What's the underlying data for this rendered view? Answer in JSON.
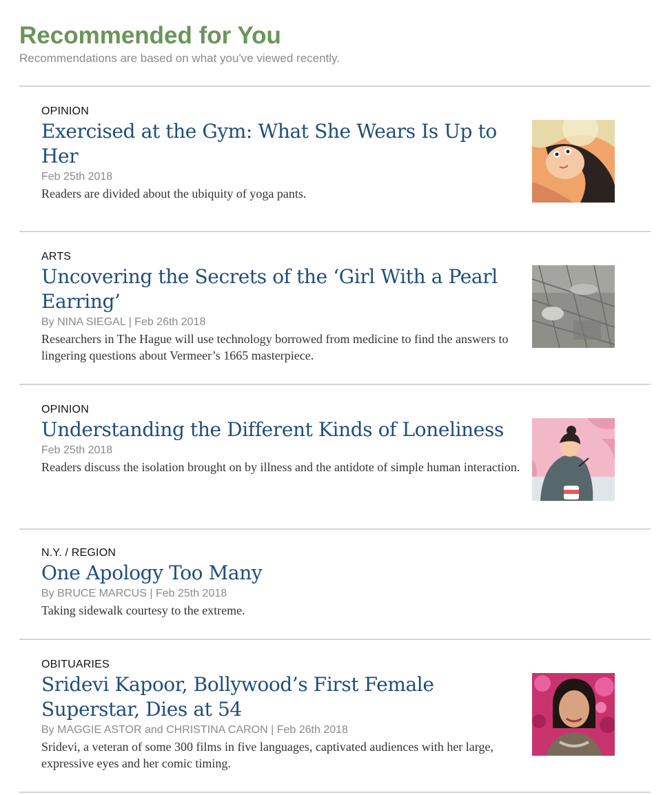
{
  "header": {
    "title": "Recommended for You",
    "subtitle": "Recommendations are based on what you've viewed recently."
  },
  "articles": [
    {
      "kicker": "OPINION",
      "headline": "Exercised at the Gym: What She Wears Is Up to Her",
      "byline": "Feb 25th 2018",
      "summary": "Readers are divided about the ubiquity of yoga pants.",
      "thumb_icon": "woman-lying-illustration"
    },
    {
      "kicker": "ARTS",
      "headline": "Uncovering the Secrets of the ‘Girl With a Pearl Earring’",
      "byline": "By NINA SIEGAL | Feb 26th 2018",
      "summary": "Researchers in The Hague will use technology borrowed from medicine to find the answers to lingering questions about Vermeer’s 1665 masterpiece.",
      "thumb_icon": "painting-scan-image"
    },
    {
      "kicker": "OPINION",
      "headline": "Understanding the Different Kinds of Loneliness",
      "byline": "Feb 25th 2018",
      "summary": "Readers discuss the isolation brought on by illness and the antidote of simple human interaction.",
      "thumb_icon": "person-with-cup-illustration"
    },
    {
      "kicker": "N.Y. / REGION",
      "headline": "One Apology Too Many",
      "byline": "By BRUCE MARCUS | Feb 25th 2018",
      "summary": "Taking sidewalk courtesy to the extreme."
    },
    {
      "kicker": "OBITUARIES",
      "headline": "Sridevi Kapoor, Bollywood’s First Female Superstar, Dies at 54",
      "byline": "By MAGGIE ASTOR and CHRISTINA CARON | Feb 26th 2018",
      "summary": "Sridevi, a veteran of some 300 films in five languages, captivated audiences with her large, expressive eyes and her comic timing.",
      "thumb_icon": "portrait-photo"
    }
  ],
  "colors": {
    "title_green": "#6a955a",
    "headline_blue": "#1f4d7a",
    "meta_gray": "#8a8a8a",
    "divider": "#d5d5d5"
  }
}
